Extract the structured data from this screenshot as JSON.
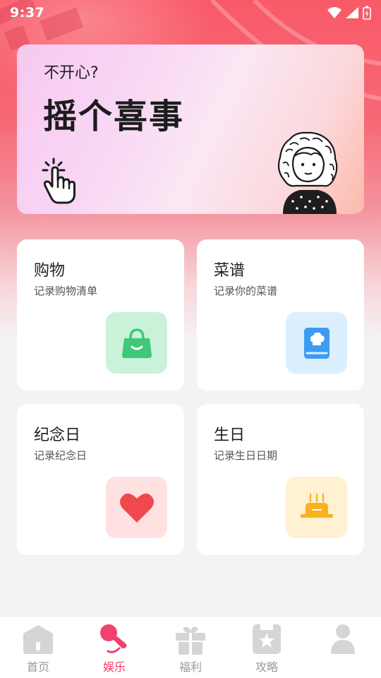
{
  "status_bar": {
    "time": "9:37"
  },
  "hero": {
    "subtitle": "不开心?",
    "title": "摇个喜事"
  },
  "cards": [
    {
      "title": "购物",
      "subtitle": "记录购物清单",
      "icon": "shopping-bag-icon",
      "icon_bg": "#c9f2d9",
      "icon_color": "#3fc77a"
    },
    {
      "title": "菜谱",
      "subtitle": "记录你的菜谱",
      "icon": "recipe-book-icon",
      "icon_bg": "#dcefff",
      "icon_color": "#3d9cf0"
    },
    {
      "title": "纪念日",
      "subtitle": "记录纪念日",
      "icon": "heart-icon",
      "icon_bg": "#ffe1e1",
      "icon_color": "#f0484c"
    },
    {
      "title": "生日",
      "subtitle": "记录生日日期",
      "icon": "birthday-cake-icon",
      "icon_bg": "#fff1d2",
      "icon_color": "#f7b21d"
    }
  ],
  "tabbar": {
    "active_color": "#f0426e",
    "tabs": [
      {
        "label": "首页",
        "icon": "home-icon",
        "active": false
      },
      {
        "label": "娱乐",
        "icon": "microphone-icon",
        "active": true
      },
      {
        "label": "福利",
        "icon": "gift-icon",
        "active": false
      },
      {
        "label": "攻略",
        "icon": "guide-book-icon",
        "active": false
      },
      {
        "label": "",
        "icon": "profile-icon",
        "active": false
      }
    ]
  }
}
